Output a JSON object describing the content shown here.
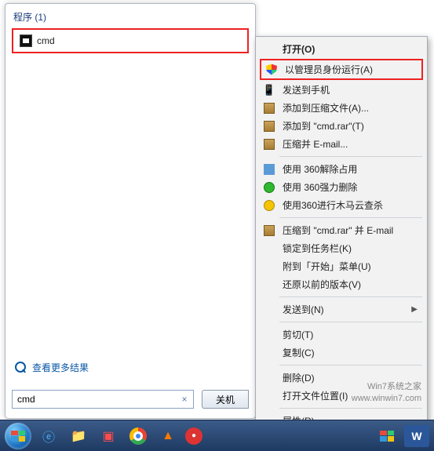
{
  "search": {
    "section_label": "程序 (1)",
    "result_label": "cmd",
    "more_results": "查看更多结果",
    "input_value": "cmd",
    "shutdown": "关机"
  },
  "context_menu": {
    "open": "打开(O)",
    "run_as_admin": "以管理员身份运行(A)",
    "send_to_phone": "发送到手机",
    "add_to_archive": "添加到压缩文件(A)...",
    "add_to_cmd_rar": "添加到 \"cmd.rar\"(T)",
    "compress_email": "压缩并 E-mail...",
    "unlock_360": "使用 360解除占用",
    "force_del_360": "使用 360强力删除",
    "trojan_scan_360": "使用360进行木马云查杀",
    "compress_cmd_rar_email": "压缩到 \"cmd.rar\" 并 E-mail",
    "pin_taskbar": "锁定到任务栏(K)",
    "pin_start": "附到「开始」菜单(U)",
    "restore_prev": "还原以前的版本(V)",
    "send_to": "发送到(N)",
    "cut": "剪切(T)",
    "copy": "复制(C)",
    "delete": "删除(D)",
    "open_location": "打开文件位置(I)",
    "properties": "属性(R)"
  },
  "watermark": {
    "line1": "Win7系统之家",
    "line2": "www.winwin7.com"
  }
}
